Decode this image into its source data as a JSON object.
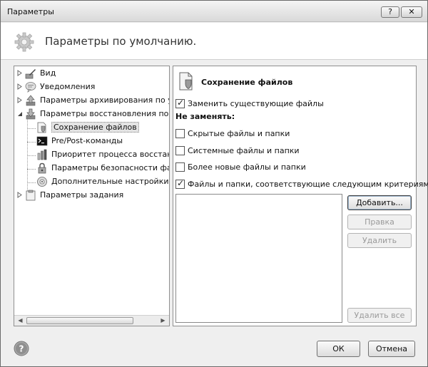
{
  "window": {
    "title": "Параметры",
    "help_glyph": "?",
    "close_glyph": "✕"
  },
  "header": {
    "title": "Параметры по умолчанию."
  },
  "tree": {
    "items": [
      {
        "label": "Вид",
        "icon": "paintbrush-icon"
      },
      {
        "label": "Уведомления",
        "icon": "notification-icon"
      },
      {
        "label": "Параметры архивирования по умолчанию",
        "icon": "backup-arrow-up-icon"
      },
      {
        "label": "Параметры восстановления по умолчанию",
        "icon": "restore-arrow-down-icon"
      },
      {
        "label": "Сохранение файлов",
        "icon": "file-shield-icon"
      },
      {
        "label": "Pre/Post-команды",
        "icon": "console-icon"
      },
      {
        "label": "Приоритет процесса восстановления",
        "icon": "priority-icon"
      },
      {
        "label": "Параметры безопасности файлов",
        "icon": "lock-icon"
      },
      {
        "label": "Дополнительные настройки",
        "icon": "gear-icon"
      },
      {
        "label": "Параметры задания",
        "icon": "clipboard-icon"
      }
    ],
    "selected": "Сохранение файлов"
  },
  "section": {
    "title": "Сохранение файлов",
    "overwrite_label": "Заменить существующие файлы",
    "overwrite_checked": true,
    "dont_replace_label": "Не заменять:",
    "hidden_label": "Скрытые файлы и папки",
    "hidden_checked": false,
    "system_label": "Системные файлы и папки",
    "system_checked": false,
    "newer_label": "Более новые файлы и папки",
    "newer_checked": false,
    "criteria_label": "Файлы и папки, соответствующие следующим критериям:",
    "criteria_checked": true,
    "criteria_list": []
  },
  "buttons": {
    "add": "Добавить...",
    "edit": "Правка",
    "delete": "Удалить",
    "delete_all": "Удалить все",
    "ok": "ОК",
    "cancel": "Отмена"
  },
  "footer": {
    "help_glyph": "?"
  }
}
